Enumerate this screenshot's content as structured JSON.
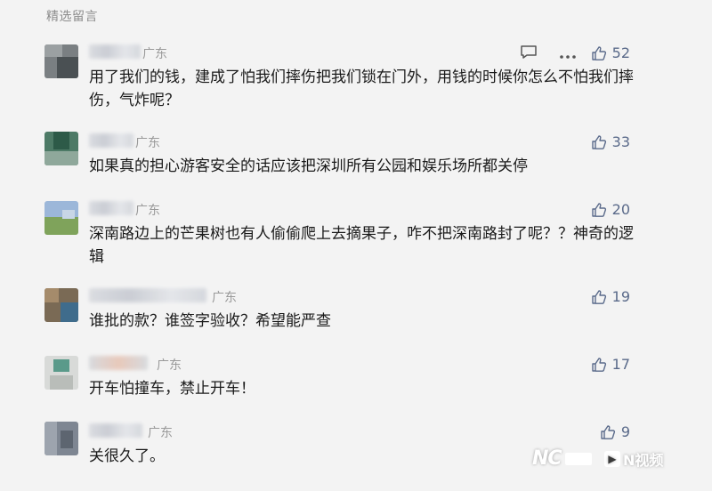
{
  "section_title": "精选留言",
  "comments": [
    {
      "region": "广东",
      "likes": "52",
      "text": "用了我们的钱，建成了怕我们摔伤把我们锁在门外，用钱的时候你怎么不怕我们摔伤，气炸呢？"
    },
    {
      "region": "广东",
      "likes": "33",
      "text": "如果真的担心游客安全的话应该把深圳所有公园和娱乐场所都关停"
    },
    {
      "region": "广东",
      "likes": "20",
      "text": "深南路边上的芒果树也有人偷偷爬上去摘果子，咋不把深南路封了呢？？神奇的逻辑"
    },
    {
      "region": "广东",
      "likes": "19",
      "text": "谁批的款？谁签字验收？希望能严查"
    },
    {
      "region": "广东",
      "likes": "17",
      "text": "开车怕撞车，禁止开车！"
    },
    {
      "region": "广东",
      "likes": "9",
      "text": "关很久了。"
    }
  ],
  "watermark": {
    "brand": "N视频"
  },
  "icons": {
    "like": "thumbs-up-icon",
    "comment": "comment-icon",
    "more": "more-icon"
  }
}
